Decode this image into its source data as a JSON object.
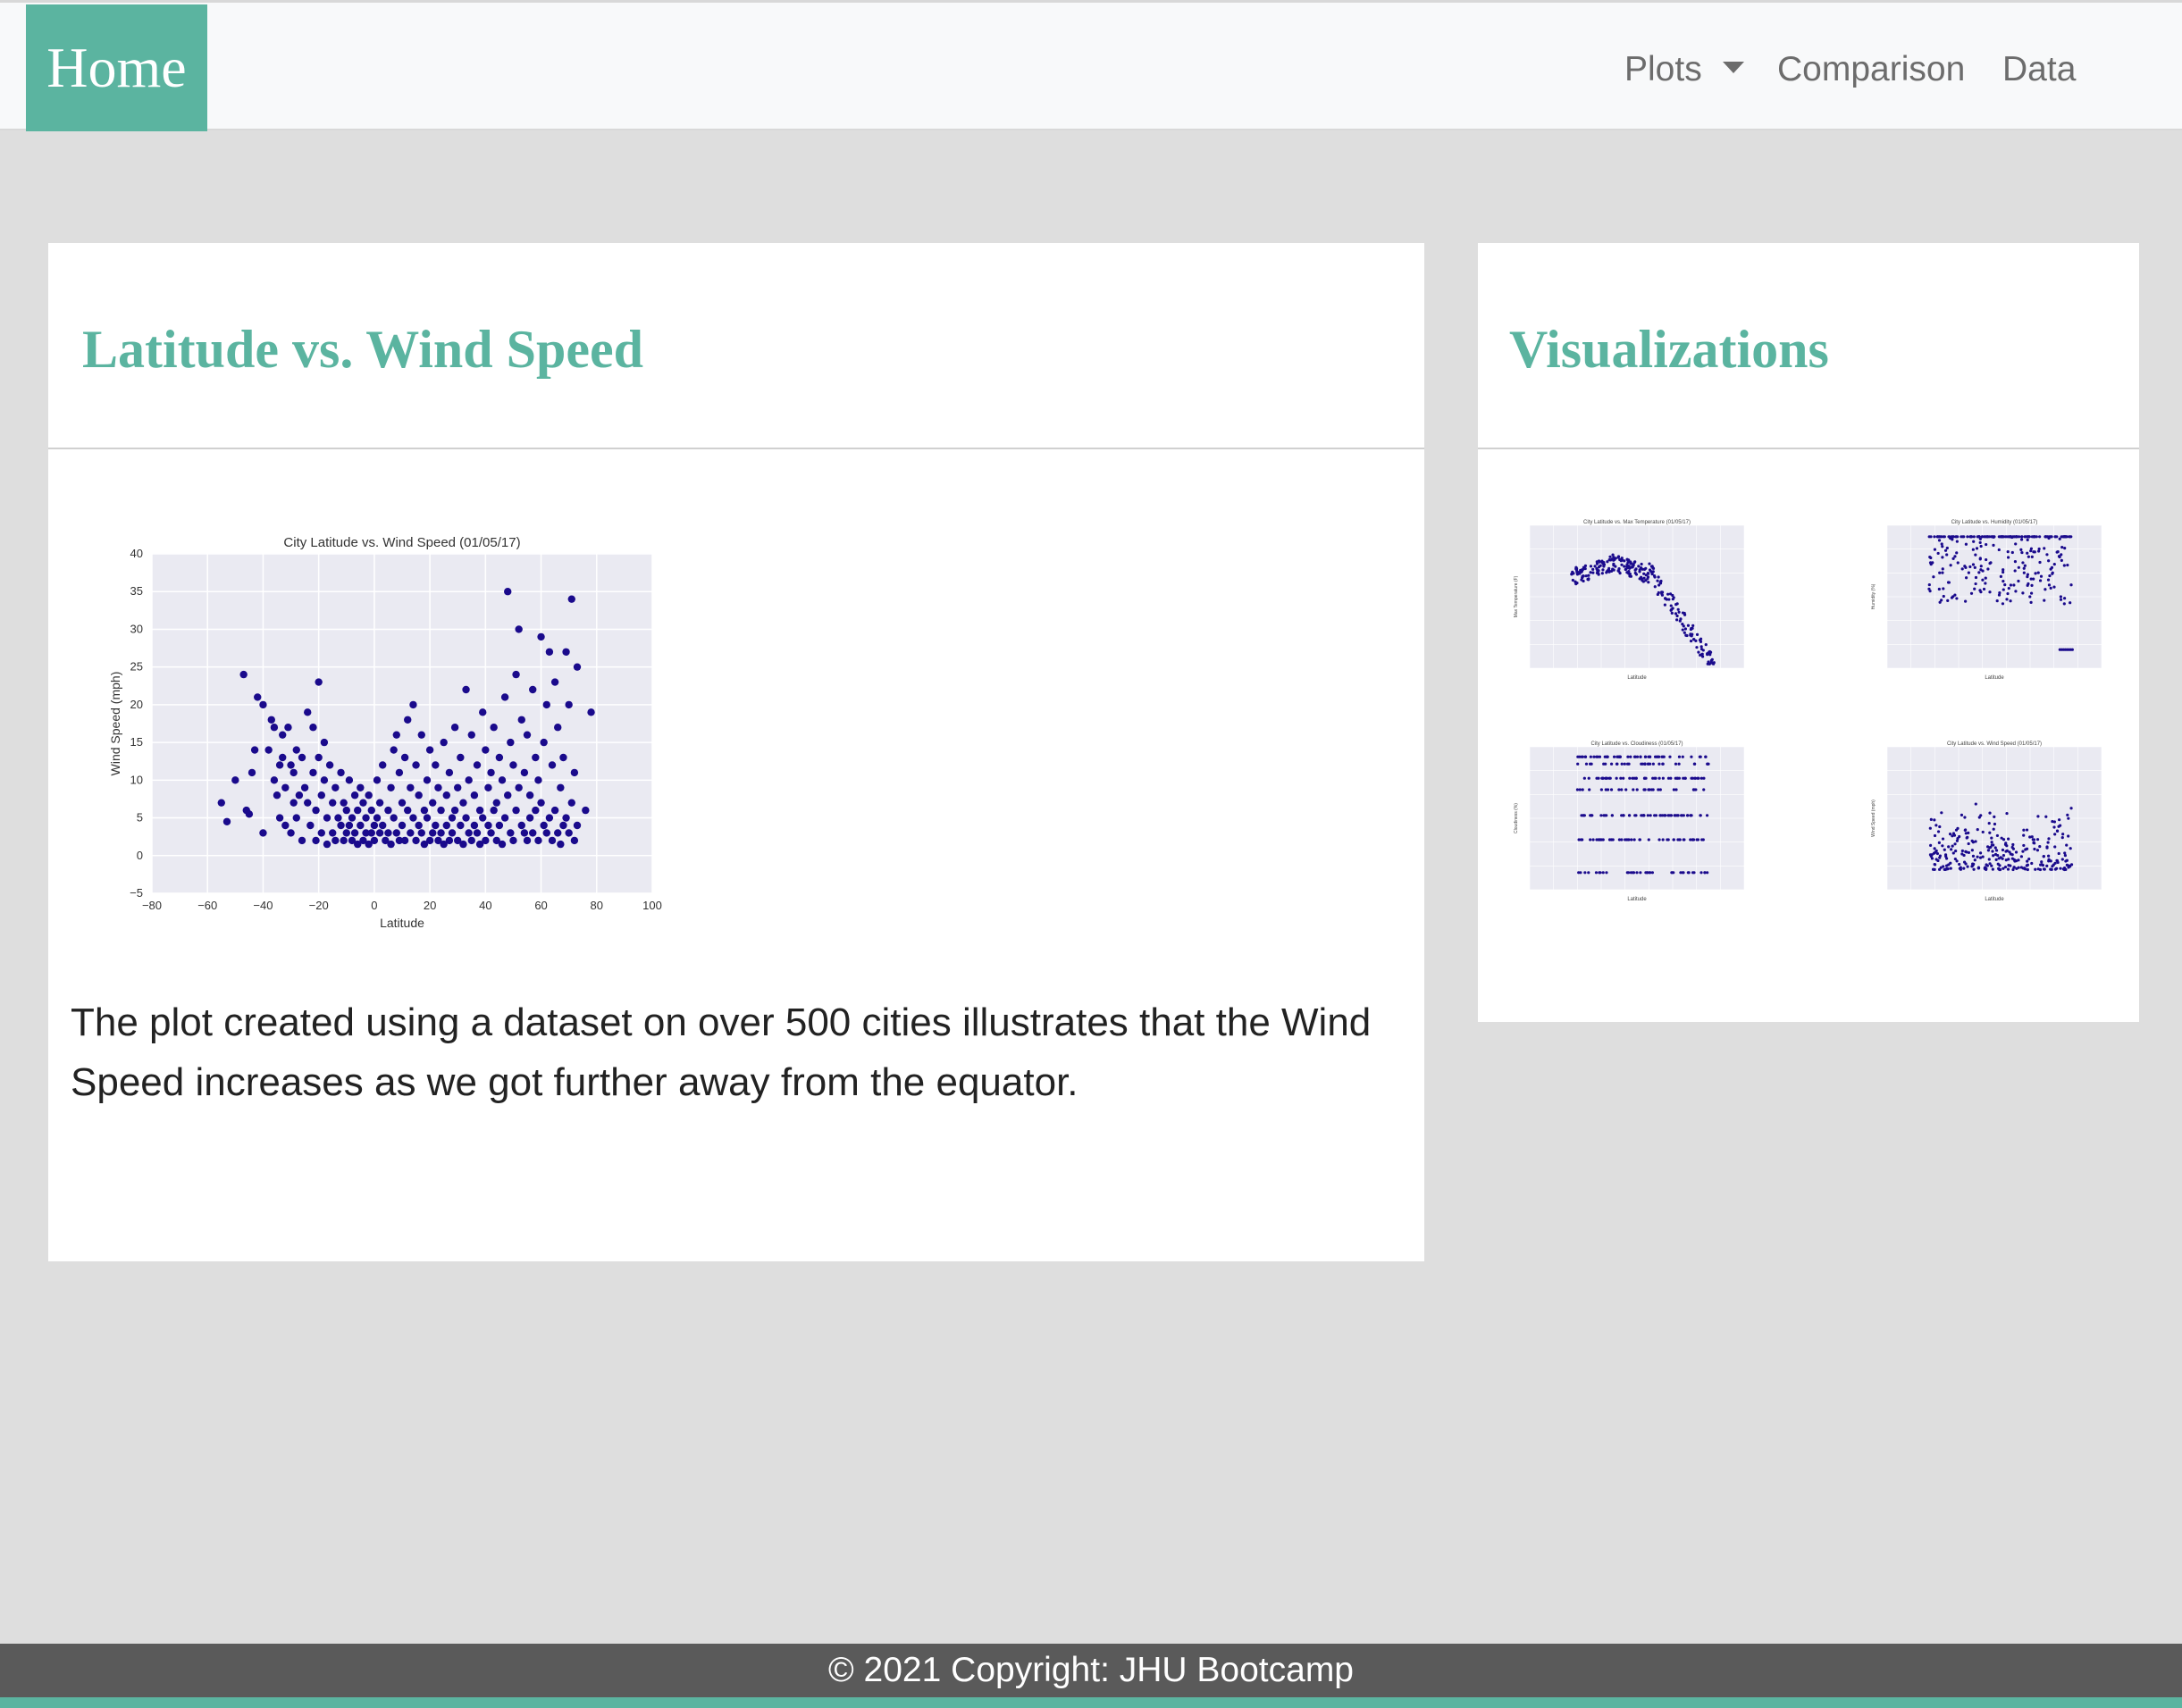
{
  "nav": {
    "brand": "Home",
    "links": [
      "Plots",
      "Comparison",
      "Data"
    ]
  },
  "main": {
    "title": "Latitude vs. Wind Speed",
    "description": "The plot created using a dataset on over 500 cities illustrates that the Wind Speed increases as we got further away from the equator."
  },
  "sidebar": {
    "title": "Visualizations",
    "thumbnails": [
      {
        "title": "City Latitude vs. Max Temperature (01/05/17)",
        "ylabel": "Max Temperature (F)",
        "xlabel": "Latitude"
      },
      {
        "title": "City Latitude vs. Humidity (01/05/17)",
        "ylabel": "Humidity (%)",
        "xlabel": "Latitude"
      },
      {
        "title": "City Latitude vs. Cloudiness (01/05/17)",
        "ylabel": "Cloudiness (%)",
        "xlabel": "Latitude"
      },
      {
        "title": "City Latitude vs. Wind Speed (01/05/17)",
        "ylabel": "Wind Speed (mph)",
        "xlabel": "Latitude"
      }
    ]
  },
  "chart_data": {
    "type": "scatter",
    "title": "City Latitude vs. Wind Speed (01/05/17)",
    "xlabel": "Latitude",
    "ylabel": "Wind Speed (mph)",
    "xlim": [
      -80,
      100
    ],
    "ylim": [
      -5,
      40
    ],
    "xticks": [
      -80,
      -60,
      -40,
      -20,
      0,
      20,
      40,
      60,
      80,
      100
    ],
    "yticks": [
      -5,
      0,
      5,
      10,
      15,
      20,
      25,
      30,
      35,
      40
    ],
    "grid": true,
    "point_color": "#1a0a8c",
    "points": [
      [
        -55,
        7
      ],
      [
        -53,
        4.5
      ],
      [
        -50,
        10
      ],
      [
        -47,
        24
      ],
      [
        -46,
        6
      ],
      [
        -45,
        5.5
      ],
      [
        -44,
        11
      ],
      [
        -43,
        14
      ],
      [
        -42,
        21
      ],
      [
        -40,
        20
      ],
      [
        -40,
        3
      ],
      [
        -38,
        14
      ],
      [
        -37,
        18
      ],
      [
        -36,
        17
      ],
      [
        -36,
        10
      ],
      [
        -35,
        8
      ],
      [
        -34,
        12
      ],
      [
        -34,
        5
      ],
      [
        -33,
        16
      ],
      [
        -33,
        13
      ],
      [
        -32,
        9
      ],
      [
        -32,
        4
      ],
      [
        -31,
        17
      ],
      [
        -30,
        12
      ],
      [
        -30,
        3
      ],
      [
        -29,
        7
      ],
      [
        -29,
        11
      ],
      [
        -28,
        14
      ],
      [
        -28,
        5
      ],
      [
        -27,
        8
      ],
      [
        -26,
        13
      ],
      [
        -26,
        2
      ],
      [
        -25,
        9
      ],
      [
        -24,
        7
      ],
      [
        -24,
        19
      ],
      [
        -23,
        4
      ],
      [
        -22,
        11
      ],
      [
        -22,
        17
      ],
      [
        -21,
        6
      ],
      [
        -21,
        2
      ],
      [
        -20,
        23
      ],
      [
        -20,
        13
      ],
      [
        -19,
        8
      ],
      [
        -19,
        3
      ],
      [
        -18,
        15
      ],
      [
        -18,
        10
      ],
      [
        -17,
        5
      ],
      [
        -17,
        1.5
      ],
      [
        -16,
        12
      ],
      [
        -15,
        7
      ],
      [
        -15,
        3
      ],
      [
        -14,
        9
      ],
      [
        -14,
        2
      ],
      [
        -13,
        5
      ],
      [
        -12,
        11
      ],
      [
        -12,
        4
      ],
      [
        -11,
        7
      ],
      [
        -11,
        2
      ],
      [
        -10,
        6
      ],
      [
        -10,
        3
      ],
      [
        -9,
        10
      ],
      [
        -9,
        4
      ],
      [
        -8,
        5
      ],
      [
        -8,
        2
      ],
      [
        -7,
        8
      ],
      [
        -7,
        3
      ],
      [
        -6,
        6
      ],
      [
        -6,
        1.5
      ],
      [
        -5,
        9
      ],
      [
        -5,
        4
      ],
      [
        -4,
        7
      ],
      [
        -4,
        2
      ],
      [
        -3,
        5
      ],
      [
        -3,
        3
      ],
      [
        -2,
        8
      ],
      [
        -2,
        1.5
      ],
      [
        -1,
        6
      ],
      [
        -1,
        3
      ],
      [
        0,
        4
      ],
      [
        0,
        2
      ],
      [
        1,
        10
      ],
      [
        1,
        5
      ],
      [
        2,
        7
      ],
      [
        2,
        3
      ],
      [
        3,
        12
      ],
      [
        3,
        4
      ],
      [
        4,
        2
      ],
      [
        5,
        6
      ],
      [
        5,
        3
      ],
      [
        6,
        9
      ],
      [
        6,
        1.5
      ],
      [
        7,
        14
      ],
      [
        7,
        5
      ],
      [
        8,
        16
      ],
      [
        8,
        3
      ],
      [
        9,
        11
      ],
      [
        9,
        2
      ],
      [
        10,
        7
      ],
      [
        10,
        4
      ],
      [
        11,
        13
      ],
      [
        11,
        2
      ],
      [
        12,
        18
      ],
      [
        12,
        6
      ],
      [
        13,
        9
      ],
      [
        13,
        3
      ],
      [
        14,
        20
      ],
      [
        14,
        5
      ],
      [
        15,
        12
      ],
      [
        15,
        2
      ],
      [
        16,
        8
      ],
      [
        16,
        4
      ],
      [
        17,
        16
      ],
      [
        17,
        3
      ],
      [
        18,
        6
      ],
      [
        18,
        1.5
      ],
      [
        19,
        10
      ],
      [
        19,
        5
      ],
      [
        20,
        14
      ],
      [
        20,
        2
      ],
      [
        21,
        7
      ],
      [
        21,
        3
      ],
      [
        22,
        12
      ],
      [
        22,
        4
      ],
      [
        23,
        9
      ],
      [
        23,
        2
      ],
      [
        24,
        6
      ],
      [
        24,
        3
      ],
      [
        25,
        15
      ],
      [
        25,
        1.5
      ],
      [
        26,
        8
      ],
      [
        26,
        4
      ],
      [
        27,
        11
      ],
      [
        27,
        2
      ],
      [
        28,
        5
      ],
      [
        28,
        3
      ],
      [
        29,
        17
      ],
      [
        29,
        6
      ],
      [
        30,
        9
      ],
      [
        30,
        2
      ],
      [
        31,
        13
      ],
      [
        31,
        4
      ],
      [
        32,
        7
      ],
      [
        32,
        1.5
      ],
      [
        33,
        22
      ],
      [
        33,
        5
      ],
      [
        34,
        10
      ],
      [
        34,
        3
      ],
      [
        35,
        16
      ],
      [
        35,
        2
      ],
      [
        36,
        8
      ],
      [
        36,
        4
      ],
      [
        37,
        12
      ],
      [
        37,
        3
      ],
      [
        38,
        6
      ],
      [
        38,
        1.5
      ],
      [
        39,
        19
      ],
      [
        39,
        5
      ],
      [
        40,
        14
      ],
      [
        40,
        2
      ],
      [
        41,
        9
      ],
      [
        41,
        4
      ],
      [
        42,
        11
      ],
      [
        42,
        3
      ],
      [
        43,
        17
      ],
      [
        43,
        6
      ],
      [
        44,
        7
      ],
      [
        44,
        2
      ],
      [
        45,
        13
      ],
      [
        45,
        4
      ],
      [
        46,
        10
      ],
      [
        46,
        1.5
      ],
      [
        47,
        21
      ],
      [
        47,
        5
      ],
      [
        48,
        35
      ],
      [
        48,
        8
      ],
      [
        49,
        15
      ],
      [
        49,
        3
      ],
      [
        50,
        12
      ],
      [
        50,
        2
      ],
      [
        51,
        24
      ],
      [
        51,
        6
      ],
      [
        52,
        30
      ],
      [
        52,
        9
      ],
      [
        53,
        18
      ],
      [
        53,
        4
      ],
      [
        54,
        11
      ],
      [
        54,
        3
      ],
      [
        55,
        16
      ],
      [
        55,
        2
      ],
      [
        56,
        8
      ],
      [
        56,
        5
      ],
      [
        57,
        22
      ],
      [
        57,
        3
      ],
      [
        58,
        13
      ],
      [
        58,
        6
      ],
      [
        59,
        10
      ],
      [
        59,
        2
      ],
      [
        60,
        29
      ],
      [
        60,
        7
      ],
      [
        61,
        15
      ],
      [
        61,
        4
      ],
      [
        62,
        20
      ],
      [
        62,
        3
      ],
      [
        63,
        27
      ],
      [
        63,
        5
      ],
      [
        64,
        12
      ],
      [
        64,
        2
      ],
      [
        65,
        23
      ],
      [
        65,
        6
      ],
      [
        66,
        17
      ],
      [
        66,
        3
      ],
      [
        67,
        9
      ],
      [
        67,
        1.5
      ],
      [
        68,
        13
      ],
      [
        68,
        4
      ],
      [
        69,
        27
      ],
      [
        69,
        5
      ],
      [
        70,
        20
      ],
      [
        70,
        3
      ],
      [
        71,
        34
      ],
      [
        71,
        7
      ],
      [
        72,
        11
      ],
      [
        72,
        2
      ],
      [
        73,
        25
      ],
      [
        73,
        4
      ],
      [
        76,
        6
      ],
      [
        78,
        19
      ]
    ]
  }
}
